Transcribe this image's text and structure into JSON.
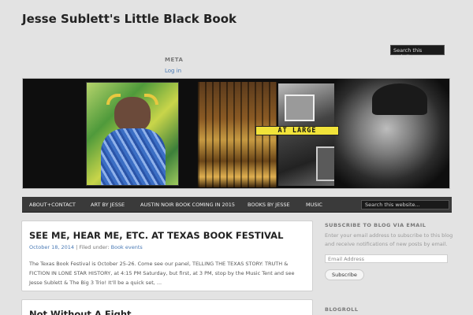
{
  "site": {
    "title": "Jesse Sublett's Little Black Book"
  },
  "meta_widget": {
    "title": "META",
    "login": "Log in"
  },
  "search": {
    "top_placeholder": "Search this website.",
    "nav_placeholder": "Search this website..."
  },
  "banner": {
    "label": "AT LARGE"
  },
  "nav": {
    "items": [
      {
        "label": "ABOUT+CONTACT"
      },
      {
        "label": "ART BY JESSE"
      },
      {
        "label": "AUSTIN NOIR BOOK COMING IN 2015"
      },
      {
        "label": "BOOKS BY JESSE"
      },
      {
        "label": "MUSIC"
      }
    ]
  },
  "posts": [
    {
      "title": "SEE ME, HEAR ME, ETC. AT TEXAS BOOK FESTIVAL",
      "date": "October 18, 2014",
      "filed_under": "Filed under:",
      "category": "Book events",
      "excerpt": "The Texas Book Festival is October 25-26. Come see our panel, TELLING THE TEXAS STORY: TRUTH & FICTION IN LONE STAR HISTORY, at 4:15 PM Saturday, but first, at 3 PM, stop by the Music Tent and see Jesse Sublett & The Big 3 Trio! It'll be a quick set, ..."
    },
    {
      "title": "Not Without A Fight"
    }
  ],
  "sidebar": {
    "subscribe": {
      "title": "SUBSCRIBE TO BLOG VIA EMAIL",
      "text": "Enter your email address to subscribe to this blog and receive notifications of new posts by email.",
      "placeholder": "Email Address",
      "button": "Subscribe"
    },
    "blogroll": {
      "title": "BLOGROLL"
    }
  },
  "colors": {
    "background": "#e3e3e3",
    "nav": "#3a3a3a",
    "link": "#4a7ab5",
    "banner_label": "#f1e33a"
  }
}
